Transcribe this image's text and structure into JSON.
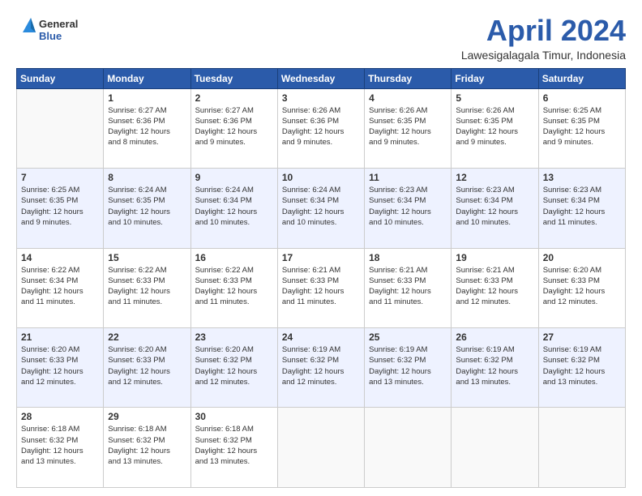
{
  "logo": {
    "general": "General",
    "blue": "Blue"
  },
  "title": "April 2024",
  "subtitle": "Lawesigalagala Timur, Indonesia",
  "weekdays": [
    "Sunday",
    "Monday",
    "Tuesday",
    "Wednesday",
    "Thursday",
    "Friday",
    "Saturday"
  ],
  "weeks": [
    [
      {
        "day": "",
        "info": ""
      },
      {
        "day": "1",
        "info": "Sunrise: 6:27 AM\nSunset: 6:36 PM\nDaylight: 12 hours\nand 8 minutes."
      },
      {
        "day": "2",
        "info": "Sunrise: 6:27 AM\nSunset: 6:36 PM\nDaylight: 12 hours\nand 9 minutes."
      },
      {
        "day": "3",
        "info": "Sunrise: 6:26 AM\nSunset: 6:36 PM\nDaylight: 12 hours\nand 9 minutes."
      },
      {
        "day": "4",
        "info": "Sunrise: 6:26 AM\nSunset: 6:35 PM\nDaylight: 12 hours\nand 9 minutes."
      },
      {
        "day": "5",
        "info": "Sunrise: 6:26 AM\nSunset: 6:35 PM\nDaylight: 12 hours\nand 9 minutes."
      },
      {
        "day": "6",
        "info": "Sunrise: 6:25 AM\nSunset: 6:35 PM\nDaylight: 12 hours\nand 9 minutes."
      }
    ],
    [
      {
        "day": "7",
        "info": "Sunrise: 6:25 AM\nSunset: 6:35 PM\nDaylight: 12 hours\nand 9 minutes."
      },
      {
        "day": "8",
        "info": "Sunrise: 6:24 AM\nSunset: 6:35 PM\nDaylight: 12 hours\nand 10 minutes."
      },
      {
        "day": "9",
        "info": "Sunrise: 6:24 AM\nSunset: 6:34 PM\nDaylight: 12 hours\nand 10 minutes."
      },
      {
        "day": "10",
        "info": "Sunrise: 6:24 AM\nSunset: 6:34 PM\nDaylight: 12 hours\nand 10 minutes."
      },
      {
        "day": "11",
        "info": "Sunrise: 6:23 AM\nSunset: 6:34 PM\nDaylight: 12 hours\nand 10 minutes."
      },
      {
        "day": "12",
        "info": "Sunrise: 6:23 AM\nSunset: 6:34 PM\nDaylight: 12 hours\nand 10 minutes."
      },
      {
        "day": "13",
        "info": "Sunrise: 6:23 AM\nSunset: 6:34 PM\nDaylight: 12 hours\nand 11 minutes."
      }
    ],
    [
      {
        "day": "14",
        "info": "Sunrise: 6:22 AM\nSunset: 6:34 PM\nDaylight: 12 hours\nand 11 minutes."
      },
      {
        "day": "15",
        "info": "Sunrise: 6:22 AM\nSunset: 6:33 PM\nDaylight: 12 hours\nand 11 minutes."
      },
      {
        "day": "16",
        "info": "Sunrise: 6:22 AM\nSunset: 6:33 PM\nDaylight: 12 hours\nand 11 minutes."
      },
      {
        "day": "17",
        "info": "Sunrise: 6:21 AM\nSunset: 6:33 PM\nDaylight: 12 hours\nand 11 minutes."
      },
      {
        "day": "18",
        "info": "Sunrise: 6:21 AM\nSunset: 6:33 PM\nDaylight: 12 hours\nand 11 minutes."
      },
      {
        "day": "19",
        "info": "Sunrise: 6:21 AM\nSunset: 6:33 PM\nDaylight: 12 hours\nand 12 minutes."
      },
      {
        "day": "20",
        "info": "Sunrise: 6:20 AM\nSunset: 6:33 PM\nDaylight: 12 hours\nand 12 minutes."
      }
    ],
    [
      {
        "day": "21",
        "info": "Sunrise: 6:20 AM\nSunset: 6:33 PM\nDaylight: 12 hours\nand 12 minutes."
      },
      {
        "day": "22",
        "info": "Sunrise: 6:20 AM\nSunset: 6:33 PM\nDaylight: 12 hours\nand 12 minutes."
      },
      {
        "day": "23",
        "info": "Sunrise: 6:20 AM\nSunset: 6:32 PM\nDaylight: 12 hours\nand 12 minutes."
      },
      {
        "day": "24",
        "info": "Sunrise: 6:19 AM\nSunset: 6:32 PM\nDaylight: 12 hours\nand 12 minutes."
      },
      {
        "day": "25",
        "info": "Sunrise: 6:19 AM\nSunset: 6:32 PM\nDaylight: 12 hours\nand 13 minutes."
      },
      {
        "day": "26",
        "info": "Sunrise: 6:19 AM\nSunset: 6:32 PM\nDaylight: 12 hours\nand 13 minutes."
      },
      {
        "day": "27",
        "info": "Sunrise: 6:19 AM\nSunset: 6:32 PM\nDaylight: 12 hours\nand 13 minutes."
      }
    ],
    [
      {
        "day": "28",
        "info": "Sunrise: 6:18 AM\nSunset: 6:32 PM\nDaylight: 12 hours\nand 13 minutes."
      },
      {
        "day": "29",
        "info": "Sunrise: 6:18 AM\nSunset: 6:32 PM\nDaylight: 12 hours\nand 13 minutes."
      },
      {
        "day": "30",
        "info": "Sunrise: 6:18 AM\nSunset: 6:32 PM\nDaylight: 12 hours\nand 13 minutes."
      },
      {
        "day": "",
        "info": ""
      },
      {
        "day": "",
        "info": ""
      },
      {
        "day": "",
        "info": ""
      },
      {
        "day": "",
        "info": ""
      }
    ]
  ]
}
